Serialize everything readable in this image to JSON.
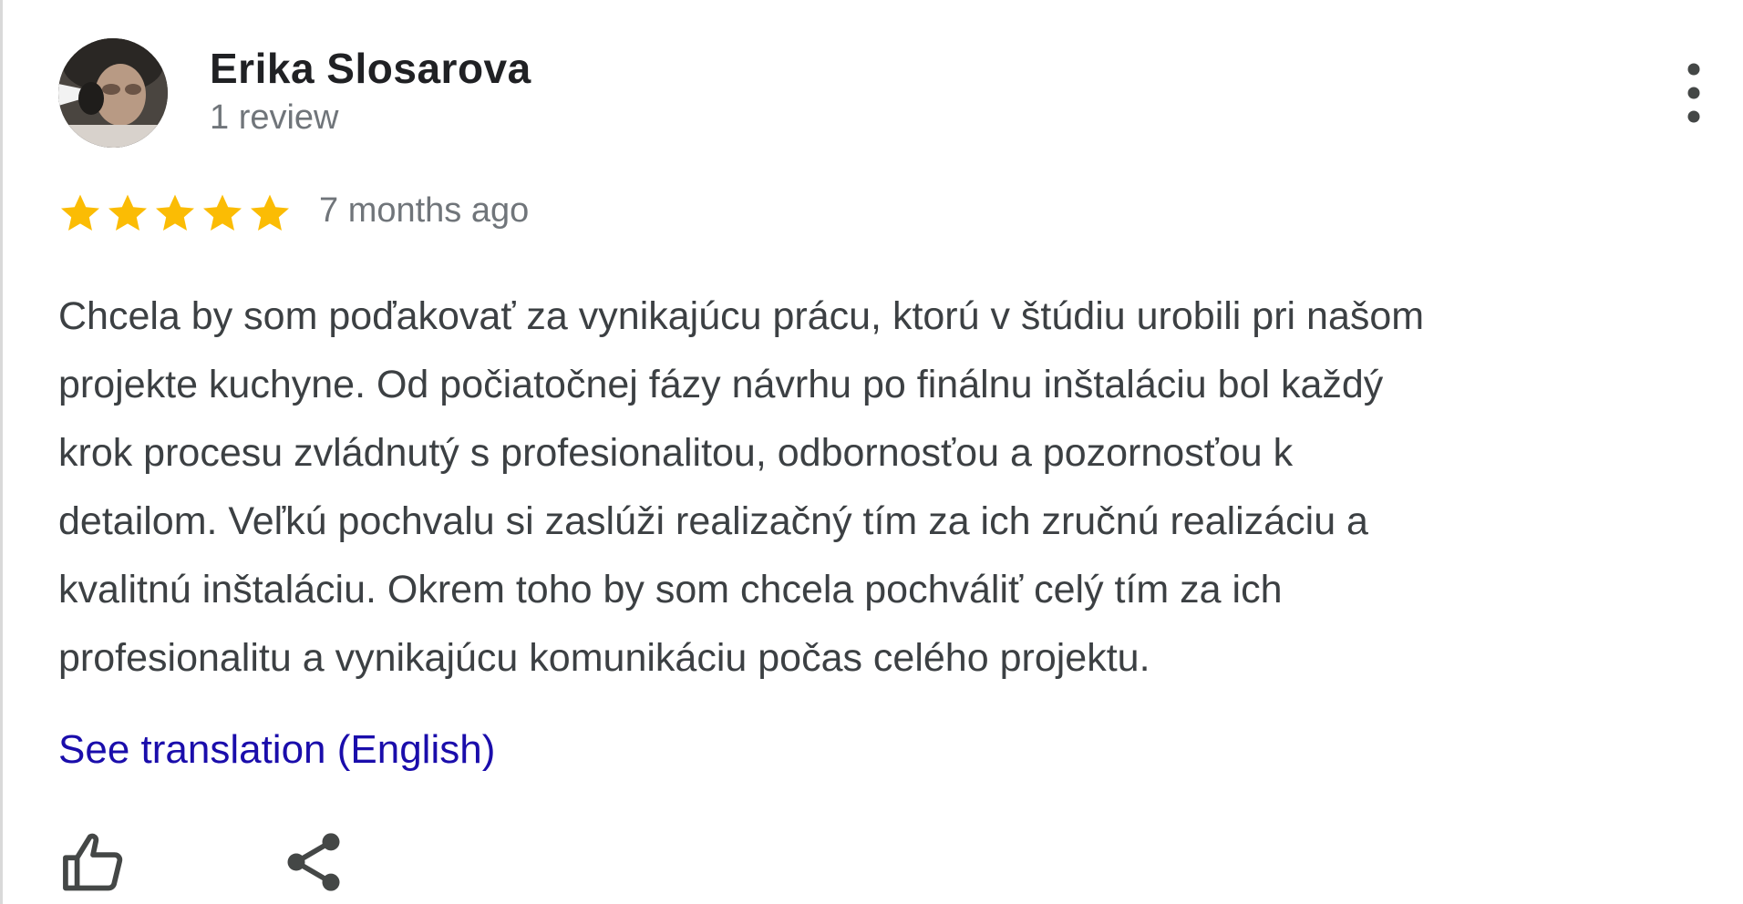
{
  "review": {
    "reviewer_name": "Erika Slosarova",
    "review_count": "1 review",
    "rating": 5,
    "rating_max": 5,
    "time_ago": "7 months ago",
    "text_lines": [
      "Chcela by som poďakovať za vynikajúcu prácu, ktorú v štúdiu urobili pri našom",
      "projekte kuchyne. Od počiatočnej fázy návrhu po finálnu inštaláciu bol každý",
      "krok procesu zvládnutý s profesionalitou, odbornosťou a pozornosťou k",
      "detailom. Veľkú pochvalu si zaslúži realizačný tím za ich zručnú realizáciu a",
      "kvalitnú inštaláciu. Okrem toho by som chcela pochváliť celý tím za ich",
      "profesionalitu a vynikajúcu komunikáciu počas celého projektu."
    ],
    "translation_link": "See translation (English)"
  },
  "icons": {
    "avatar": "avatar-photo",
    "more": "more-vert-icon",
    "star": "star-icon",
    "like": "thumb-up-icon",
    "share": "share-icon"
  },
  "colors": {
    "star": "#fbbc04",
    "link": "#1a0dab",
    "name": "#202124",
    "secondary": "#70757a",
    "body_text": "#3c4043",
    "icon": "#444746"
  }
}
